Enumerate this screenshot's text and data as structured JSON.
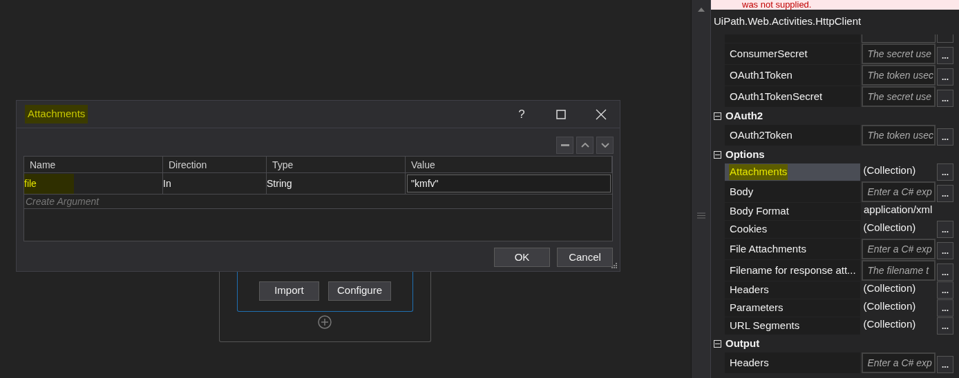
{
  "error_banner": {
    "text": "was not supplied."
  },
  "designer": {
    "buttons": [
      "Import",
      "Configure"
    ]
  },
  "dialog": {
    "title": "Attachments",
    "title_highlighted": true,
    "help": "?",
    "columns": [
      "Name",
      "Direction",
      "Type",
      "Value"
    ],
    "arguments": [
      {
        "name": "file",
        "direction": "In",
        "type": "String",
        "value": "\"kmfv\"",
        "highlighted": true
      }
    ],
    "create_placeholder": "Create Argument",
    "buttons": [
      "OK",
      "Cancel"
    ]
  },
  "properties": {
    "title": "UiPath.Web.Activities.HttpClient",
    "rows": [
      {
        "kind": "partial"
      },
      {
        "kind": "expression",
        "name": "ConsumerSecret",
        "placeholder": "The secret use",
        "selected": false,
        "highlighted": false
      },
      {
        "kind": "expression",
        "name": "OAuth1Token",
        "placeholder": "The token usec",
        "selected": false,
        "highlighted": false
      },
      {
        "kind": "expression",
        "name": "OAuth1TokenSecret",
        "placeholder": "The secret use",
        "selected": false,
        "highlighted": false
      },
      {
        "kind": "category",
        "name": "OAuth2",
        "expanded": true
      },
      {
        "kind": "expression",
        "name": "OAuth2Token",
        "placeholder": "The token usec",
        "selected": false,
        "highlighted": false
      },
      {
        "kind": "category",
        "name": "Options",
        "expanded": true
      },
      {
        "kind": "collection",
        "name": "Attachments",
        "value": "(Collection)",
        "selected": true,
        "highlighted": true
      },
      {
        "kind": "expression",
        "name": "Body",
        "placeholder": "Enter a C# exp",
        "selected": false,
        "highlighted": false
      },
      {
        "kind": "text",
        "name": "Body Format",
        "value": "application/xml",
        "selected": false,
        "highlighted": false
      },
      {
        "kind": "collection",
        "name": "Cookies",
        "value": "(Collection)",
        "selected": false,
        "highlighted": false
      },
      {
        "kind": "expression",
        "name": "File Attachments",
        "placeholder": "Enter a C# exp",
        "selected": false,
        "highlighted": false
      },
      {
        "kind": "expression",
        "name": "Filename for response att...",
        "placeholder": "The filename t",
        "selected": false,
        "highlighted": false
      },
      {
        "kind": "collection",
        "name": "Headers",
        "value": "(Collection)",
        "selected": false,
        "highlighted": false
      },
      {
        "kind": "collection",
        "name": "Parameters",
        "value": "(Collection)",
        "selected": false,
        "highlighted": false
      },
      {
        "kind": "collection",
        "name": "URL Segments",
        "value": "(Collection)",
        "selected": false,
        "highlighted": false
      },
      {
        "kind": "category",
        "name": "Output",
        "expanded": true
      },
      {
        "kind": "expression",
        "name": "Headers",
        "placeholder": "Enter a C# exp",
        "selected": false,
        "highlighted": false
      }
    ],
    "ellipsis": "..."
  }
}
